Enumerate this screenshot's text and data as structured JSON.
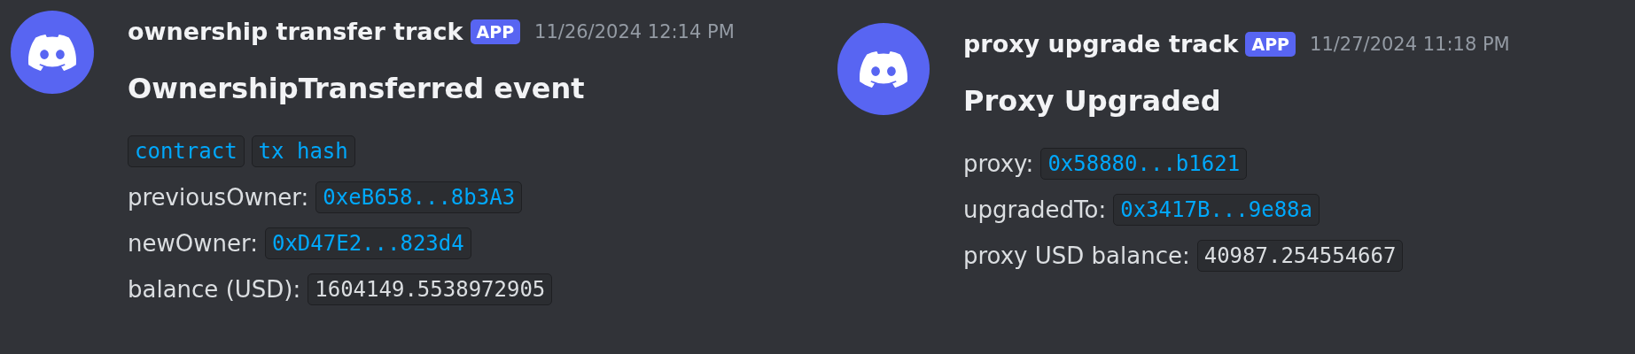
{
  "messages": [
    {
      "author": "ownership transfer track",
      "badge": "APP",
      "timestamp": "11/26/2024 12:14 PM",
      "title": "OwnershipTransferred event",
      "links": [
        "contract",
        "tx hash"
      ],
      "fields": [
        {
          "label": "previousOwner:",
          "value": "0xeB658...8b3A3",
          "kind": "link"
        },
        {
          "label": "newOwner:",
          "value": "0xD47E2...823d4",
          "kind": "link"
        },
        {
          "label": "balance (USD):",
          "value": "1604149.5538972905",
          "kind": "plain"
        }
      ]
    },
    {
      "author": "proxy upgrade track",
      "badge": "APP",
      "timestamp": "11/27/2024 11:18 PM",
      "title": "Proxy Upgraded",
      "fields": [
        {
          "label": "proxy:",
          "value": "0x58880...b1621",
          "kind": "link"
        },
        {
          "label": "upgradedTo:",
          "value": "0x3417B...9e88a",
          "kind": "link"
        },
        {
          "label": "proxy USD balance:",
          "value": "40987.254554667",
          "kind": "plain"
        }
      ]
    }
  ]
}
